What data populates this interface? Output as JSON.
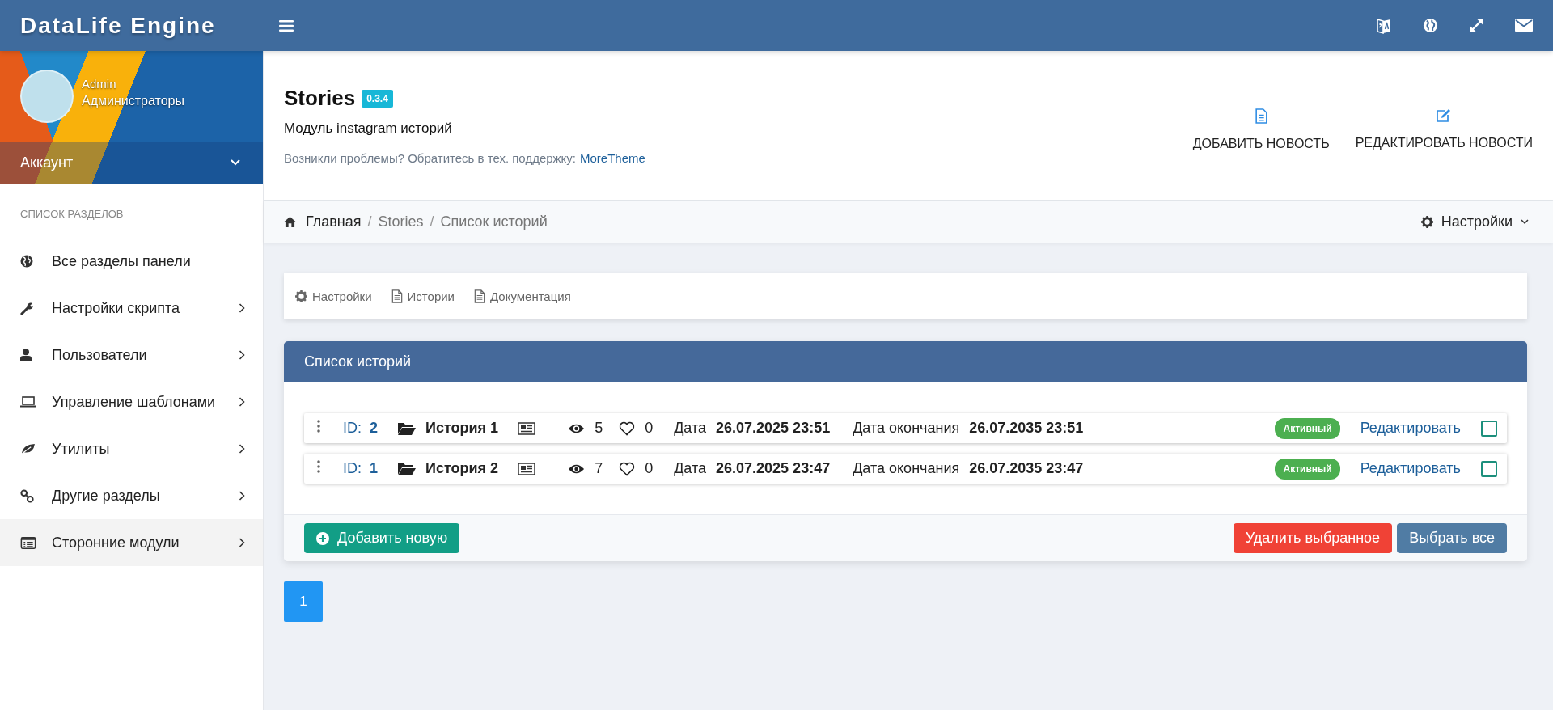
{
  "app": {
    "logo": "DataLife Engine"
  },
  "user": {
    "name": "Admin",
    "group": "Администраторы",
    "account_label": "Аккаунт"
  },
  "sidebar": {
    "heading": "СПИСОК РАЗДЕЛОВ",
    "items": [
      {
        "label": "Все разделы панели",
        "has_submenu": false,
        "selected": false
      },
      {
        "label": "Настройки скрипта",
        "has_submenu": true,
        "selected": false
      },
      {
        "label": "Пользователи",
        "has_submenu": true,
        "selected": false
      },
      {
        "label": "Управление шаблонами",
        "has_submenu": true,
        "selected": false
      },
      {
        "label": "Утилиты",
        "has_submenu": true,
        "selected": false
      },
      {
        "label": "Другие разделы",
        "has_submenu": true,
        "selected": false
      },
      {
        "label": "Сторонние модули",
        "has_submenu": true,
        "selected": true
      }
    ]
  },
  "page": {
    "title": "Stories",
    "version": "0.3.4",
    "subtitle": "Модуль instagram историй",
    "help_text": "Возникли проблемы? Обратитесь в тех. поддержку:",
    "help_link": "MoreTheme",
    "actions": [
      "ДОБАВИТЬ НОВОСТЬ",
      "РЕДАКТИРОВАТЬ НОВОСТИ"
    ]
  },
  "breadcrumbs": [
    "Главная",
    "Stories",
    "Список историй"
  ],
  "breadcrumb_separator": "/",
  "settings_menu": "Настройки",
  "module_tabs": [
    "Настройки",
    "Истории",
    "Документация"
  ],
  "panel": {
    "title": "Список историй",
    "rows": [
      {
        "id_label": "ID:",
        "id": "2",
        "title": "История 1",
        "views": "5",
        "likes": "0",
        "date_label": "Дата",
        "date": "26.07.2025 23:51",
        "end_label": "Дата окончания",
        "end_date": "26.07.2035 23:51",
        "status": "Активный",
        "edit": "Редактировать",
        "checked": false
      },
      {
        "id_label": "ID:",
        "id": "1",
        "title": "История 2",
        "views": "7",
        "likes": "0",
        "date_label": "Дата",
        "date": "26.07.2025 23:47",
        "end_label": "Дата окончания",
        "end_date": "26.07.2035 23:47",
        "status": "Активный",
        "edit": "Редактировать",
        "checked": false
      }
    ],
    "add_button": "Добавить новую",
    "delete_button": "Удалить выбранное",
    "select_all_button": "Выбрать все"
  },
  "pagination": [
    {
      "label": "1",
      "selected": true
    }
  ]
}
